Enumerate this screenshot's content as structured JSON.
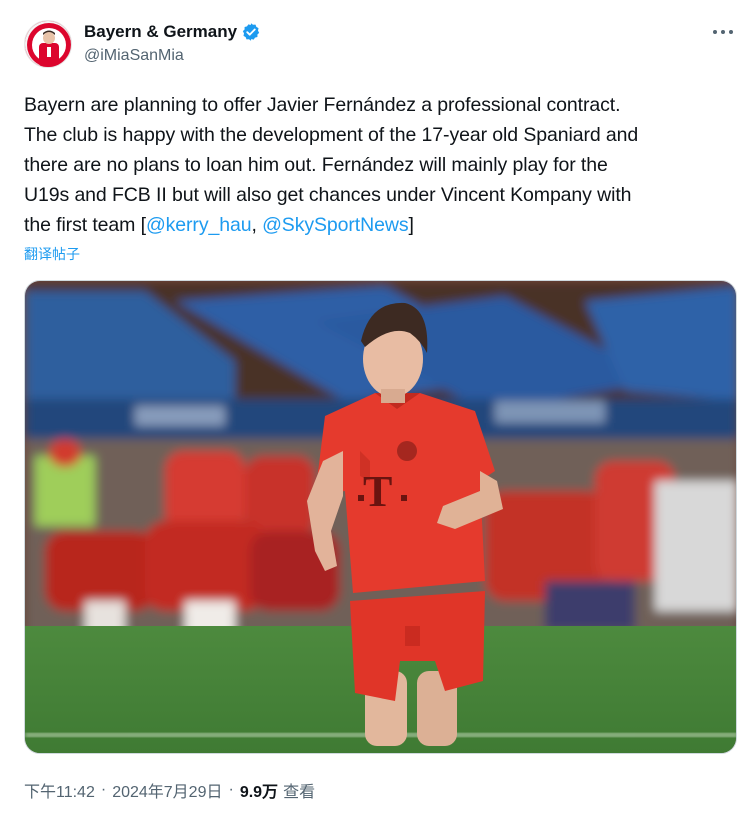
{
  "author": {
    "display_name": "Bayern & Germany",
    "handle": "@iMiaSanMia",
    "verified": true,
    "avatar_icon": "bayern-player-avatar"
  },
  "tweet": {
    "lines": [
      "Bayern are planning to offer Javier Fernández a professional contract.",
      "The club is happy with the development of the 17-year old Spaniard and",
      "there are no plans to loan him out. Fernández will mainly play for the",
      "U19s and FCB II but will also get chances under Vincent Kompany with"
    ],
    "last_line_prefix": "the first team [",
    "mention_1": "@kerry_hau",
    "separator": ", ",
    "mention_2": "@SkySportNews",
    "last_line_suffix": "]",
    "translate_label": "翻译帖子"
  },
  "media": {
    "description_icon": "football-player-photo"
  },
  "meta": {
    "time": "下午11:42",
    "dot": "·",
    "date": "2024年7月29日",
    "views_count": "9.9万",
    "views_label": "查看"
  },
  "colors": {
    "link": "#1d9bf0",
    "secondary": "#536471",
    "bayern_red": "#dc052d"
  }
}
